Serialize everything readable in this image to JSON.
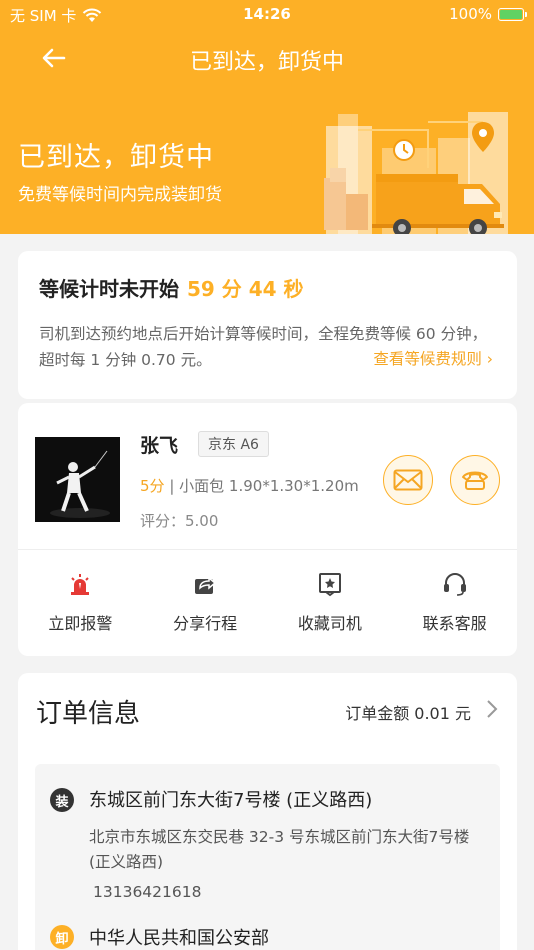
{
  "status_bar": {
    "carrier": "无 SIM 卡",
    "time": "14:26",
    "battery": "100%"
  },
  "nav": {
    "title": "已到达，卸货中"
  },
  "hero": {
    "title": "已到达，卸货中",
    "subtitle": "免费等候时间内完成装卸货"
  },
  "wait": {
    "title": "等候计时未开始",
    "countdown": "59 分 44 秒",
    "description": "司机到达预约地点后开始计算等候时间，全程免费等候 60 分钟，超时每 1 分钟 0.70 元。",
    "rules_link": "查看等候费规则 ›"
  },
  "driver": {
    "name": "张飞",
    "plate": "京东 A6",
    "score": "5分",
    "vehicle": "| 小面包 1.90*1.30*1.20m",
    "rating": "评分：5.00"
  },
  "actions": [
    {
      "label": "立即报警",
      "icon": "alarm-icon"
    },
    {
      "label": "分享行程",
      "icon": "share-icon"
    },
    {
      "label": "收藏司机",
      "icon": "favorite-icon"
    },
    {
      "label": "联系客服",
      "icon": "headset-icon"
    }
  ],
  "order": {
    "title": "订单信息",
    "amount": "订单金额 0.01 元",
    "load": {
      "tag": "装",
      "title": "东城区前门东大街7号楼 (正义路西)",
      "detail": "北京市东城区东交民巷 32-3 号东城区前门东大街7号楼 (正义路西)",
      "phone": "13136421618"
    },
    "unload": {
      "tag": "卸",
      "title": "中华人民共和国公安部"
    }
  },
  "colors": {
    "accent": "#fdb026",
    "alarm": "#e53935"
  }
}
